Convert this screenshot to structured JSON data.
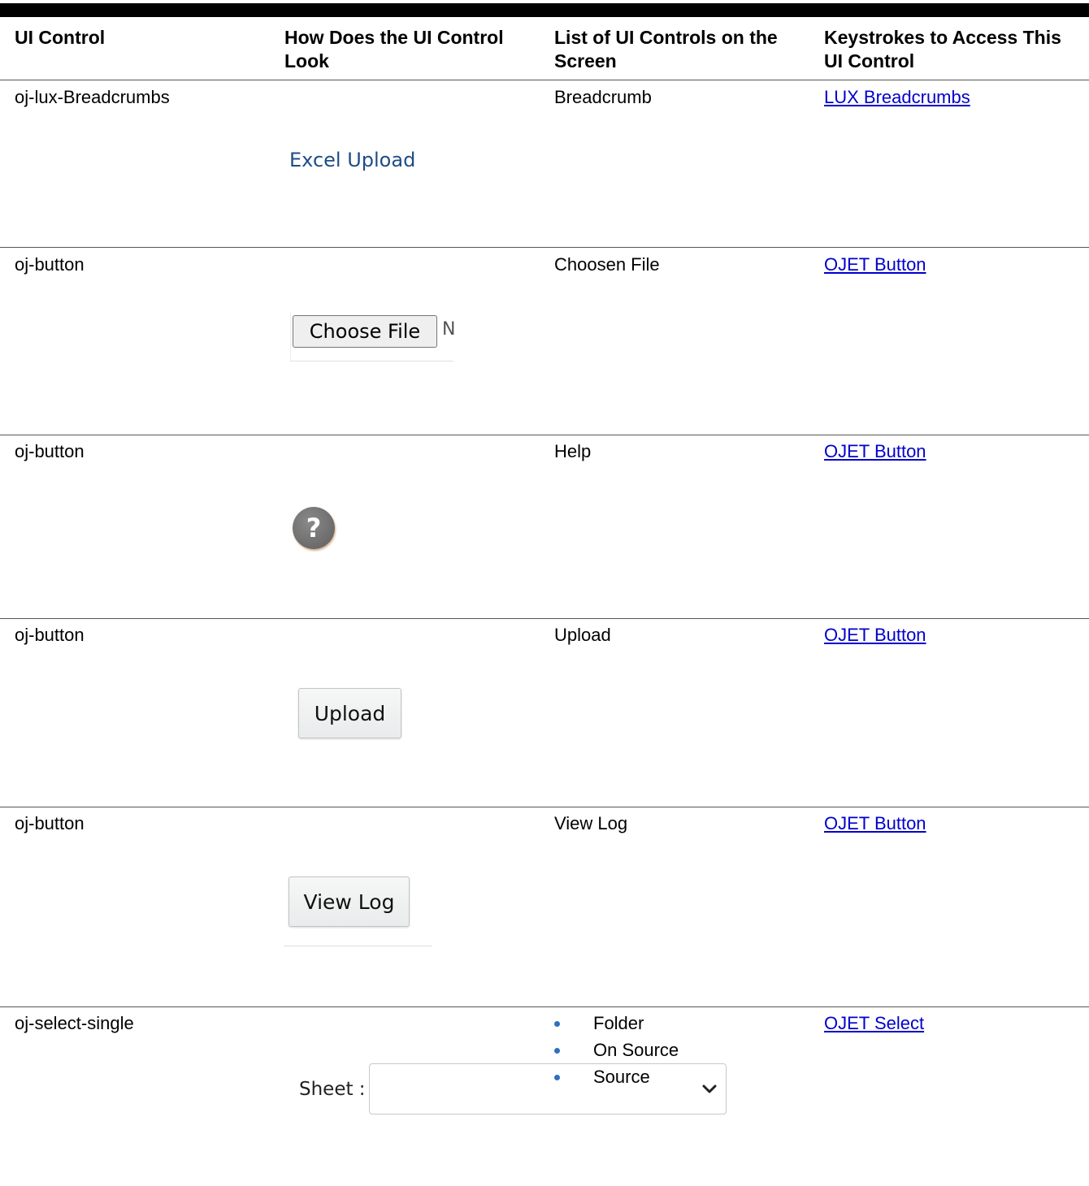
{
  "headers": {
    "col1": "UI Control",
    "col2": "How Does the UI Control Look",
    "col3": "List of UI Controls on the Screen",
    "col4": "Keystrokes to Access This UI Control"
  },
  "rows": [
    {
      "control": "oj-lux-Breadcrumbs",
      "list": "Breadcrumb",
      "link": "LUX Breadcrumbs",
      "preview_text": "Excel Upload"
    },
    {
      "control": "oj-button",
      "list": "Choosen File",
      "link": "OJET Button",
      "preview_text": "Choose File",
      "preview_suffix": "N"
    },
    {
      "control": "oj-button",
      "list": "Help",
      "link": "OJET Button",
      "preview_icon": "help-question-icon",
      "preview_glyph": "?"
    },
    {
      "control": "oj-button",
      "list": "Upload",
      "link": "OJET Button",
      "preview_text": "Upload"
    },
    {
      "control": "oj-button",
      "list": "View Log",
      "link": "OJET Button",
      "preview_text": "View Log"
    },
    {
      "control": "oj-select-single",
      "list_items": [
        "Folder",
        "On Source",
        "Source"
      ],
      "link": "OJET Select",
      "preview_label": "Sheet :",
      "preview_icon": "chevron-down-icon"
    }
  ],
  "colors": {
    "link": "#0000cc",
    "breadcrumb": "#1f4d85",
    "bullet": "#2f6fbf",
    "help_icon": "#6e6e6e"
  }
}
